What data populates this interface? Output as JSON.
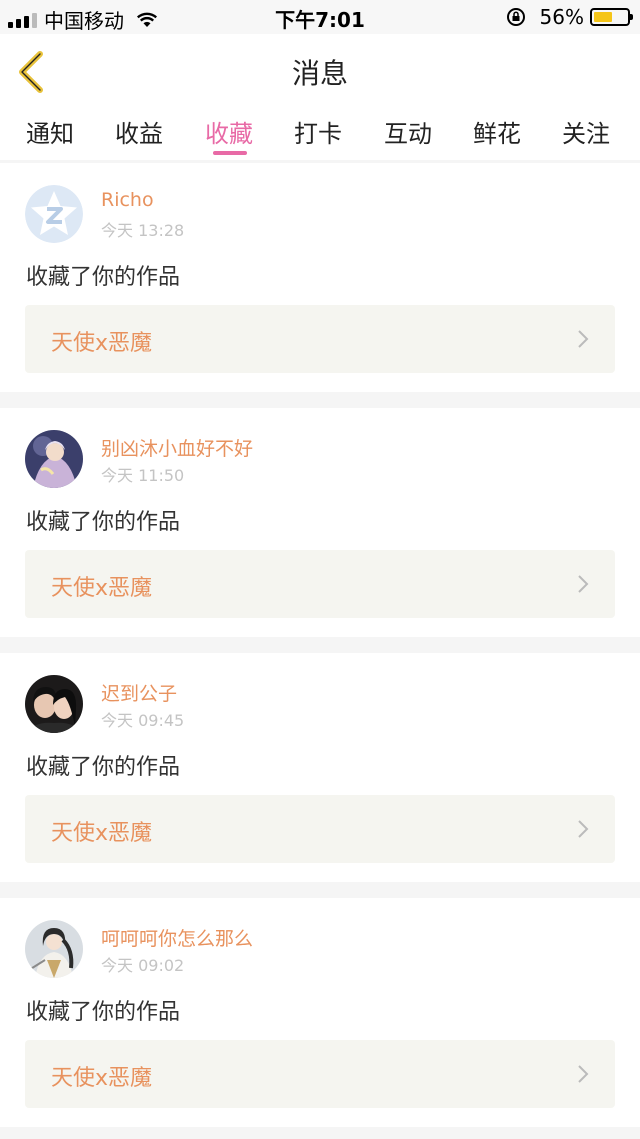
{
  "status_bar": {
    "carrier": "中国移动",
    "time": "下午7:01",
    "battery_pct": "56%",
    "battery_level": 0.56
  },
  "header": {
    "title": "消息"
  },
  "tabs": [
    {
      "label": "通知",
      "active": false
    },
    {
      "label": "收益",
      "active": false
    },
    {
      "label": "收藏",
      "active": true
    },
    {
      "label": "打卡",
      "active": false
    },
    {
      "label": "互动",
      "active": false
    },
    {
      "label": "鲜花",
      "active": false
    },
    {
      "label": "关注",
      "active": false
    }
  ],
  "messages": [
    {
      "user": "Richo",
      "time": "今天 13:28",
      "action": "收藏了你的作品",
      "work": "天使x恶魔"
    },
    {
      "user": "别凶沐小血好不好",
      "time": "今天 11:50",
      "action": "收藏了你的作品",
      "work": "天使x恶魔"
    },
    {
      "user": "迟到公子",
      "time": "今天 09:45",
      "action": "收藏了你的作品",
      "work": "天使x恶魔"
    },
    {
      "user": "呵呵呵你怎么那么",
      "time": "今天 09:02",
      "action": "收藏了你的作品",
      "work": "天使x恶魔"
    }
  ],
  "colors": {
    "accent_pink": "#e86aa6",
    "accent_orange": "#e8925e",
    "back_yellow": "#e8c23a"
  }
}
